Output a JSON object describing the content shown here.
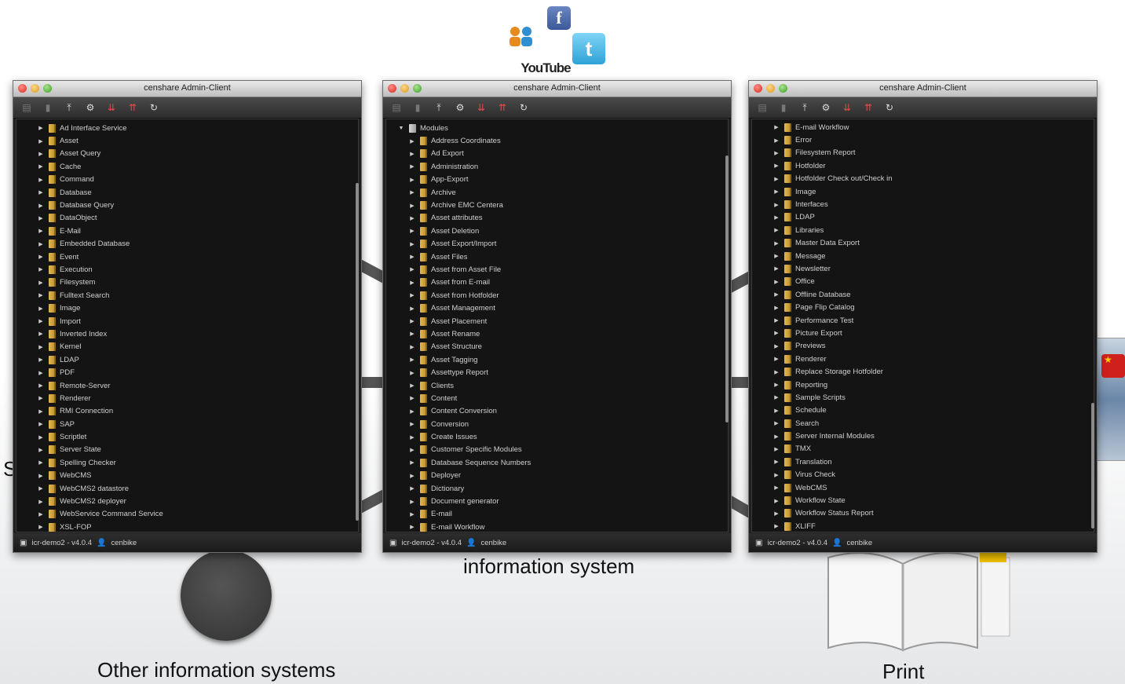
{
  "captions": {
    "other_systems": "Other information systems",
    "info_system": "information system",
    "print": "Print",
    "partial_left": "S"
  },
  "social": {
    "youtube": "YouTube"
  },
  "windows": [
    {
      "title": "censhare Admin-Client",
      "status_server": "icr-demo2 - v4.0.4",
      "status_user": "cenbike",
      "items": [
        "Ad Interface Service",
        "Asset",
        "Asset Query",
        "Cache",
        "Command",
        "Database",
        "Database Query",
        "DataObject",
        "E-Mail",
        "Embedded Database",
        "Event",
        "Execution",
        "Filesystem",
        "Fulltext Search",
        "Image",
        "Import",
        "Inverted Index",
        "Kernel",
        "LDAP",
        "PDF",
        "Remote-Server",
        "Renderer",
        "RMI Connection",
        "SAP",
        "Scriptlet",
        "Server State",
        "Spelling Checker",
        "WebCMS",
        "WebCMS2 datastore",
        "WebCMS2 deployer",
        "WebService Command Service",
        "XSL-FOP"
      ]
    },
    {
      "title": "censhare Admin-Client",
      "status_server": "icr-demo2 - v4.0.4",
      "status_user": "cenbike",
      "root": "Modules",
      "items": [
        "Address Coordinates",
        "Ad Export",
        "Administration",
        "App-Export",
        "Archive",
        "Archive EMC Centera",
        "Asset attributes",
        "Asset Deletion",
        "Asset Export/Import",
        "Asset Files",
        "Asset from Asset File",
        "Asset from E-mail",
        "Asset from Hotfolder",
        "Asset Management",
        "Asset Placement",
        "Asset Rename",
        "Asset Structure",
        "Asset Tagging",
        "Assettype Report",
        "Clients",
        "Content",
        "Content Conversion",
        "Conversion",
        "Create Issues",
        "Customer Specific Modules",
        "Database Sequence Numbers",
        "Deployer",
        "Dictionary",
        "Document generator",
        "E-mail",
        "E-mail Workflow"
      ]
    },
    {
      "title": "censhare Admin-Client",
      "status_server": "icr-demo2 - v4.0.4",
      "status_user": "cenbike",
      "items": [
        "E-mail Workflow",
        "Error",
        "Filesystem Report",
        "Hotfolder",
        "Hotfolder Check out/Check in",
        "Image",
        "Interfaces",
        "LDAP",
        "Libraries",
        "Master Data Export",
        "Message",
        "Newsletter",
        "Office",
        "Offline Database",
        "Page Flip Catalog",
        "Performance Test",
        "Picture Export",
        "Previews",
        "Renderer",
        "Replace Storage Hotfolder",
        "Reporting",
        "Sample Scripts",
        "Schedule",
        "Search",
        "Server Internal Modules",
        "TMX",
        "Translation",
        "Virus Check",
        "WebCMS",
        "Workflow State",
        "Workflow Status Report",
        "XLIFF"
      ]
    }
  ],
  "colors": {
    "accent": "#e84a4a",
    "doc_icon": "#d6a63c",
    "window_bg": "#1f1f1f"
  }
}
